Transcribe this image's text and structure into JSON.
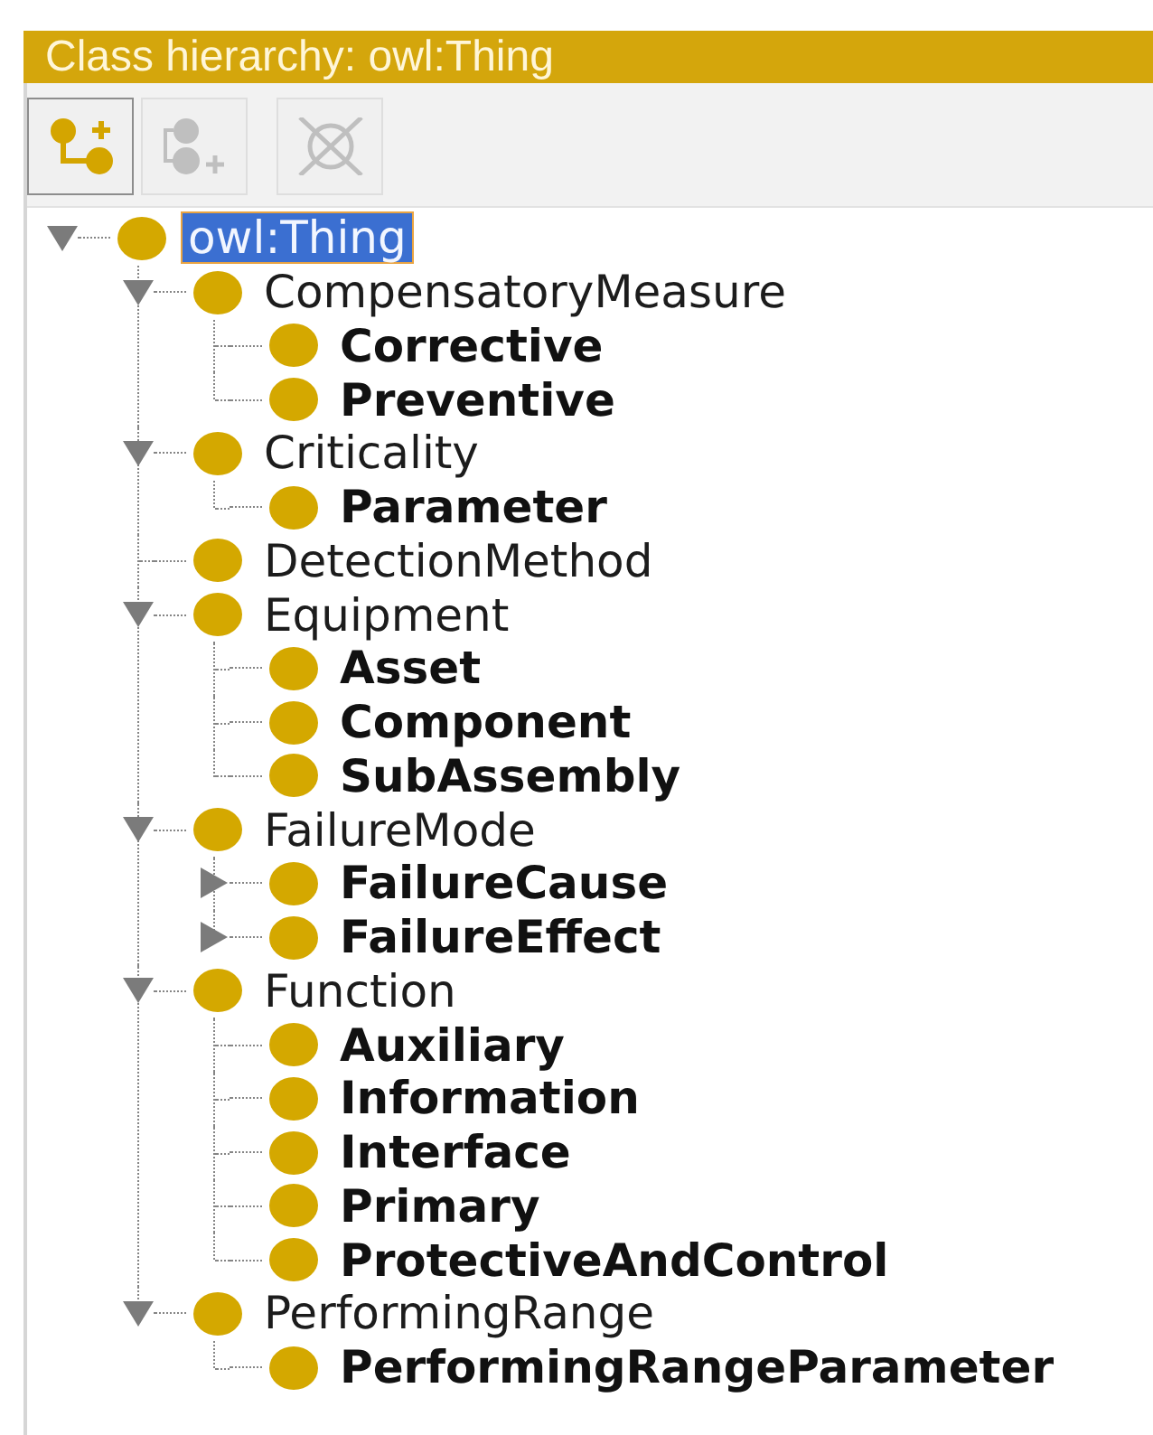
{
  "panel": {
    "title": "Class hierarchy: owl:Thing"
  },
  "toolbar": [
    {
      "kind": "add_subclass",
      "disabled": false
    },
    {
      "kind": "add_sibling",
      "disabled": true
    },
    {
      "kind": "delete",
      "disabled": true
    }
  ],
  "tree": [
    {
      "label": "owl:Thing",
      "bold": false,
      "selected": true,
      "expanded": true,
      "children": [
        {
          "label": "CompensatoryMeasure",
          "bold": false,
          "selected": false,
          "expanded": true,
          "children": [
            {
              "label": "Corrective",
              "bold": true,
              "selected": false
            },
            {
              "label": "Preventive",
              "bold": true,
              "selected": false
            }
          ]
        },
        {
          "label": "Criticality",
          "bold": false,
          "selected": false,
          "expanded": true,
          "children": [
            {
              "label": "Parameter",
              "bold": true,
              "selected": false
            }
          ]
        },
        {
          "label": "DetectionMethod",
          "bold": false,
          "selected": false
        },
        {
          "label": "Equipment",
          "bold": false,
          "selected": false,
          "expanded": true,
          "children": [
            {
              "label": "Asset",
              "bold": true,
              "selected": false
            },
            {
              "label": "Component",
              "bold": true,
              "selected": false
            },
            {
              "label": "SubAssembly",
              "bold": true,
              "selected": false
            }
          ]
        },
        {
          "label": "FailureMode",
          "bold": false,
          "selected": false,
          "expanded": true,
          "children": [
            {
              "label": "FailureCause",
              "bold": true,
              "selected": false,
              "expanded": false
            },
            {
              "label": "FailureEffect",
              "bold": true,
              "selected": false,
              "expanded": false
            }
          ]
        },
        {
          "label": "Function",
          "bold": false,
          "selected": false,
          "expanded": true,
          "children": [
            {
              "label": "Auxiliary",
              "bold": true,
              "selected": false
            },
            {
              "label": "Information",
              "bold": true,
              "selected": false
            },
            {
              "label": "Interface",
              "bold": true,
              "selected": false
            },
            {
              "label": "Primary",
              "bold": true,
              "selected": false
            },
            {
              "label": "ProtectiveAndControl",
              "bold": true,
              "selected": false
            }
          ]
        },
        {
          "label": "PerformingRange",
          "bold": false,
          "selected": false,
          "expanded": true,
          "children": [
            {
              "label": "PerformingRangeParameter",
              "bold": true,
              "selected": false
            }
          ]
        }
      ]
    }
  ]
}
